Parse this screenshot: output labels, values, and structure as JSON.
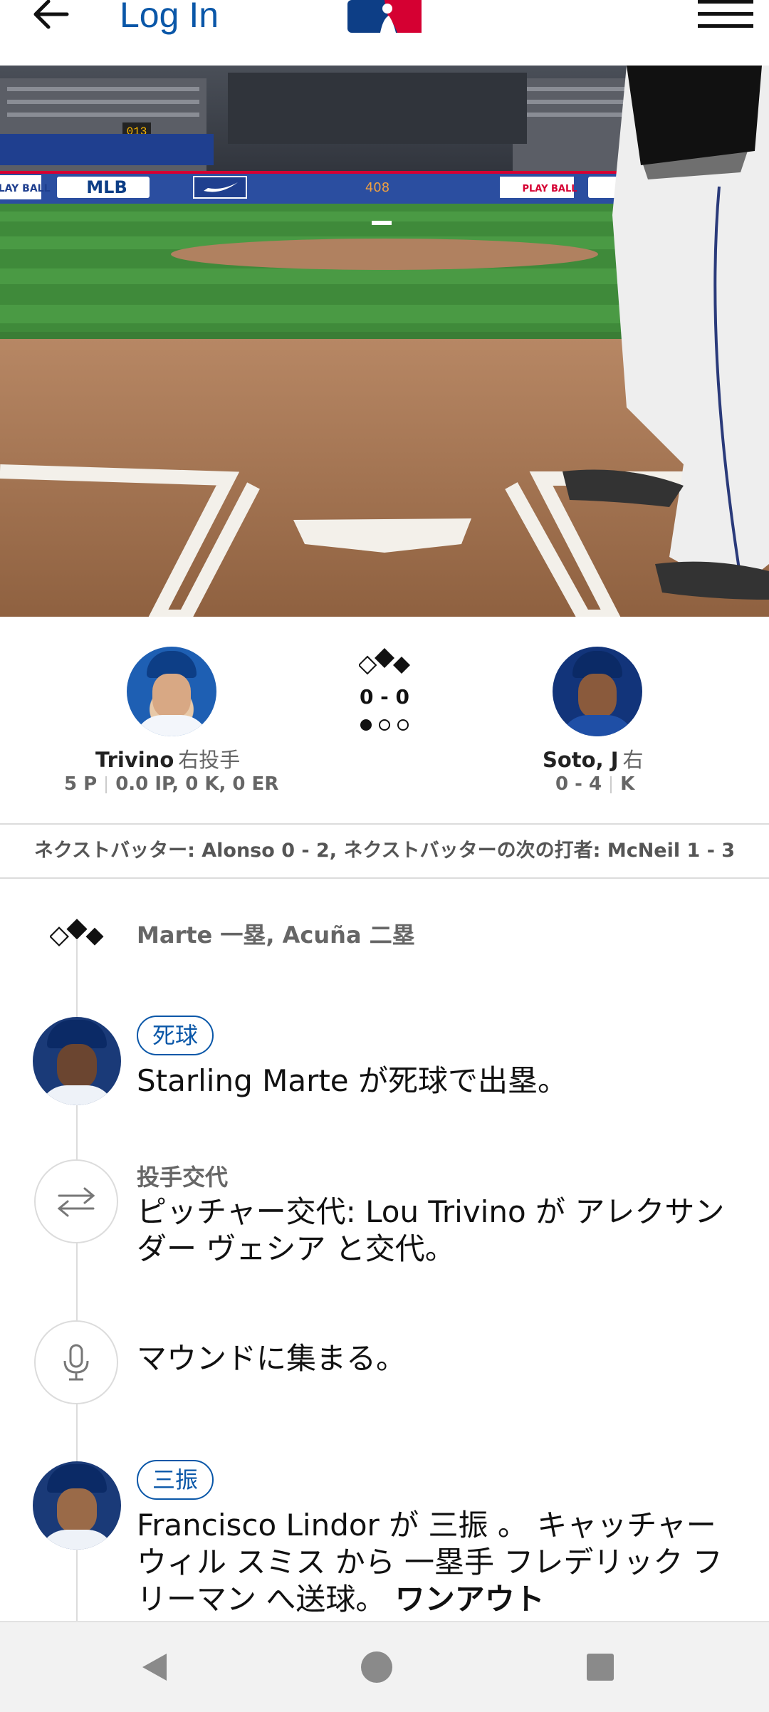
{
  "header": {
    "back_icon": "arrow-left-icon",
    "login_label": "Log In",
    "logo": "mlb-logo",
    "menu_icon": "hamburger-menu-icon"
  },
  "scene": {
    "ads": [
      "MLB",
      "408",
      "PLAY BALL",
      "PLAY BALL"
    ],
    "scoreboard_digits": "013"
  },
  "matchup": {
    "pitcher": {
      "name": "Trivino",
      "position": "右投手",
      "pitches": "5 P",
      "line": "0.0 IP, 0 K, 0 ER"
    },
    "count": "0 - 0",
    "outs": 1,
    "batter": {
      "name": "Soto, J",
      "position": "右",
      "hits": "0 - 4",
      "result": "K"
    }
  },
  "next_batter": "ネクストバッター: Alonso 0 - 2, ネクストバッターの次の打者: McNeil 1 - 3",
  "feed": {
    "bases_text": "Marte 一塁, Acuña 二塁",
    "events": [
      {
        "badge": "死球",
        "text": "Starling Marte が死球で出塁。"
      },
      {
        "label": "投手交代",
        "text": "ピッチャー交代: Lou Trivino が アレクサンダー ヴェシア と交代。"
      },
      {
        "text": "マウンドに集まる。"
      },
      {
        "badge": "三振",
        "text": "Francisco Lindor が 三振 。 キャッチャー ウィル スミス から 一塁手 フレデリック フリーマン へ送球。",
        "text_bold": "ワンアウト"
      }
    ]
  },
  "colors": {
    "accent": "#0a57a8",
    "navy": "#0d3e86",
    "grass": "#3f8a3a",
    "dirt": "#a27452"
  }
}
